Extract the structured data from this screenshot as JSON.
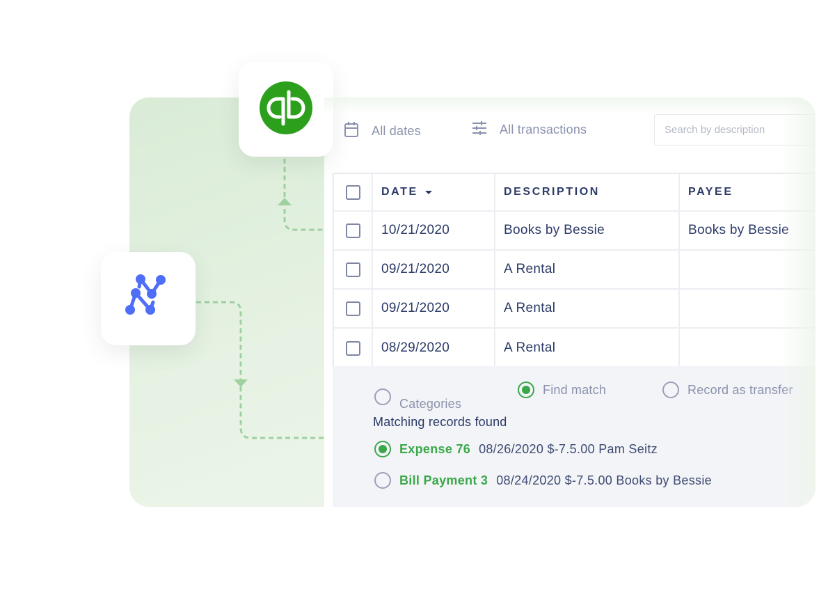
{
  "apps": {
    "quickbooks": {
      "name": "QuickBooks",
      "icon": "quickbooks-logo-icon",
      "color": "#2ca01c"
    },
    "integration": {
      "name": "Integration app",
      "icon": "node-graph-logo-icon",
      "color": "#4f6ef7"
    }
  },
  "filters": {
    "dates_label": "All dates",
    "dates_icon": "calendar-icon",
    "transactions_label": "All transactions",
    "transactions_icon": "sliders-icon"
  },
  "search": {
    "placeholder": "Search by description",
    "value": ""
  },
  "table": {
    "columns": [
      {
        "label": "DATE",
        "sort": "descending"
      },
      {
        "label": "DESCRIPTION"
      },
      {
        "label": "PAYEE"
      }
    ],
    "rows": [
      {
        "date": "10/21/2020",
        "description": "Books by Bessie",
        "payee": "Books by Bessie",
        "checked": false
      },
      {
        "date": "09/21/2020",
        "description": "A Rental",
        "payee": "",
        "checked": false
      },
      {
        "date": "09/21/2020",
        "description": "A Rental",
        "payee": "",
        "checked": false
      },
      {
        "date": "08/29/2020",
        "description": "A Rental",
        "payee": "",
        "checked": false
      }
    ]
  },
  "detail": {
    "options": [
      {
        "label": "Categories",
        "selected": false
      },
      {
        "label": "Find match",
        "selected": true
      },
      {
        "label": "Record as transfer",
        "selected": false
      }
    ],
    "matches_title": "Matching records found",
    "matches": [
      {
        "name": "Expense 76",
        "info": "08/26/2020 $-7.5.00 Pam Seitz",
        "selected": true
      },
      {
        "name": "Bill Payment 3",
        "info": "08/24/2020 $-7.5.00 Books by Bessie",
        "selected": false
      }
    ]
  },
  "colors": {
    "accent_green": "#3aa849",
    "text_navy": "#2b3a67",
    "muted_text": "#8a92ad",
    "connector_green": "#9fd0a0"
  }
}
